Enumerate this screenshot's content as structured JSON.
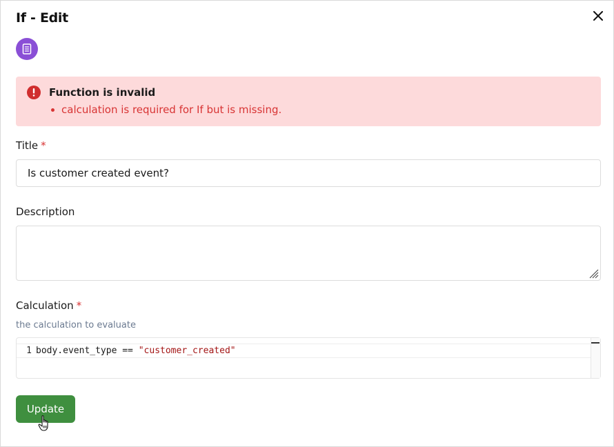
{
  "dialog": {
    "title": "If - Edit",
    "type_icon": "document-icon",
    "close_icon": "close-icon"
  },
  "alert": {
    "icon": "exclamation-icon",
    "title": "Function is invalid",
    "items": [
      "calculation is required for If but is missing."
    ]
  },
  "fields": {
    "title": {
      "label": "Title",
      "required_marker": "*",
      "value": "Is customer created event?"
    },
    "description": {
      "label": "Description",
      "value": ""
    },
    "calculation": {
      "label": "Calculation",
      "required_marker": "*",
      "helper": "the calculation to evaluate",
      "line_number": "1",
      "code_plain": "body.event_type == ",
      "code_string": "\"customer_created\""
    }
  },
  "actions": {
    "update_label": "Update"
  },
  "colors": {
    "accent_purple": "#8a4fd6",
    "error_red": "#d83434",
    "alert_bg": "#fddadb",
    "button_green": "#3f8f3f"
  }
}
